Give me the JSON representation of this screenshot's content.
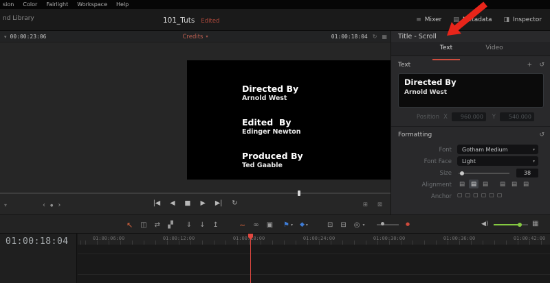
{
  "menu_bar": {
    "items": [
      "sion",
      "Color",
      "Fairlight",
      "Workspace",
      "Help"
    ]
  },
  "header": {
    "library_label": "nd Library",
    "project_title": "101_Tuts",
    "edited_badge": "Edited",
    "buttons": {
      "mixer": "Mixer",
      "metadata": "Metadata",
      "inspector": "Inspector"
    },
    "icons": {
      "mixer": "≡",
      "metadata": "▤",
      "inspector": "◨"
    }
  },
  "viewer": {
    "timecode_left": "00:00:23:06",
    "clip_menu_label": "Credits",
    "timecode_right": "01:00:18:04",
    "icons": {
      "left_caret": "▾",
      "menu_caret": "▾",
      "refresh": "↻",
      "options": "▦",
      "collapse": "▾",
      "prev": "‹",
      "dot": "●",
      "next": "›",
      "match_frame": "⊞",
      "fullscreen": "⊠"
    },
    "credits": [
      {
        "role": "Directed By",
        "name": "Arnold West"
      },
      {
        "role": "Edited  By",
        "name": "Edinger Newton"
      },
      {
        "role": "Produced By",
        "name": "Ted Gaable"
      }
    ],
    "transport": {
      "jump_start": "|◀",
      "step_back": "◀",
      "stop": "■",
      "play": "▶",
      "step_forward": "▶|",
      "loop": "↻"
    }
  },
  "inspector": {
    "title": "Title - Scroll",
    "tabs": [
      {
        "label": "Text"
      },
      {
        "label": "Video"
      }
    ],
    "text_section": {
      "label": "Text",
      "plus_icon": "+",
      "reset_icon": "↺",
      "content": {
        "line1": "Directed By",
        "line2": "Arnold West"
      },
      "position": {
        "label": "Position",
        "x_label": "X",
        "x_value": "960.000",
        "y_label": "Y",
        "y_value": "540.000"
      }
    },
    "formatting": {
      "label": "Formatting",
      "reset_icon": "↺",
      "font_label": "Font",
      "font_value": "Gotham Medium",
      "font_face_label": "Font Face",
      "font_face_value": "Light",
      "size_label": "Size",
      "size_value": "38",
      "alignment_label": "Alignment",
      "align_icon": "▤",
      "anchor_label": "Anchor",
      "anchor_icon": "▢",
      "dropdown_caret": "▾"
    }
  },
  "toolbar": {
    "icons": {
      "select": "↖",
      "trim": "◫",
      "dynamic_trim": "⇄",
      "blade": "▞",
      "insert": "⇓",
      "overwrite": "↓",
      "replace": "↥",
      "retime": "∼",
      "link": "∞",
      "lock": "▣",
      "flag": "⚑",
      "marker": "◆",
      "caret": "▾",
      "box_zoom": "⊡",
      "fit_zoom": "⊟",
      "magnify": "◎",
      "indicator": "●",
      "speaker": "◀)",
      "view_options": "▦"
    }
  },
  "timeline": {
    "timecode": "01:00:18:04",
    "ruler_labels": [
      "01:00:06:00",
      "01:00:12:00",
      "01:00:18:00",
      "01:00:24:00",
      "01:00:30:00",
      "01:00:36:00",
      "01:00:42:00"
    ]
  },
  "colors": {
    "accent_red": "#cf4d3e",
    "arrow_red": "#e8251a",
    "flag_blue": "#3e7cd6",
    "volume_green": "#84c941",
    "playhead_red": "#e14840"
  }
}
